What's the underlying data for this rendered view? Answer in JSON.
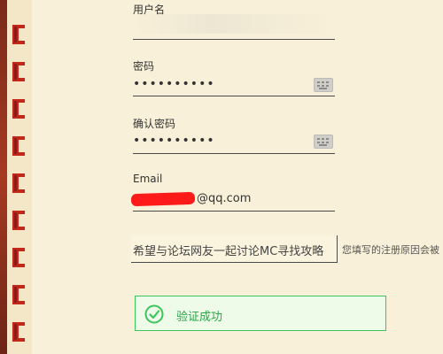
{
  "form": {
    "username": {
      "label": "用户名",
      "value": ""
    },
    "password": {
      "label": "密码",
      "value": "••••••••••"
    },
    "confirm_password": {
      "label": "确认密码",
      "value": "••••••••••"
    },
    "email": {
      "label": "Email",
      "visible_suffix": "@qq.com"
    },
    "reason": {
      "value": "希望与论坛网友一起讨论MC寻找攻略",
      "hint": "您填写的注册原因会被"
    },
    "verification": {
      "status_text": "验证成功"
    }
  },
  "colors": {
    "background": "#f8f0d8",
    "border_red": "#c2271a",
    "success_green": "#3cc55c",
    "success_text": "#2aa447"
  },
  "icons": {
    "keyboard": "keyboard-icon",
    "check": "check-circle-icon"
  }
}
